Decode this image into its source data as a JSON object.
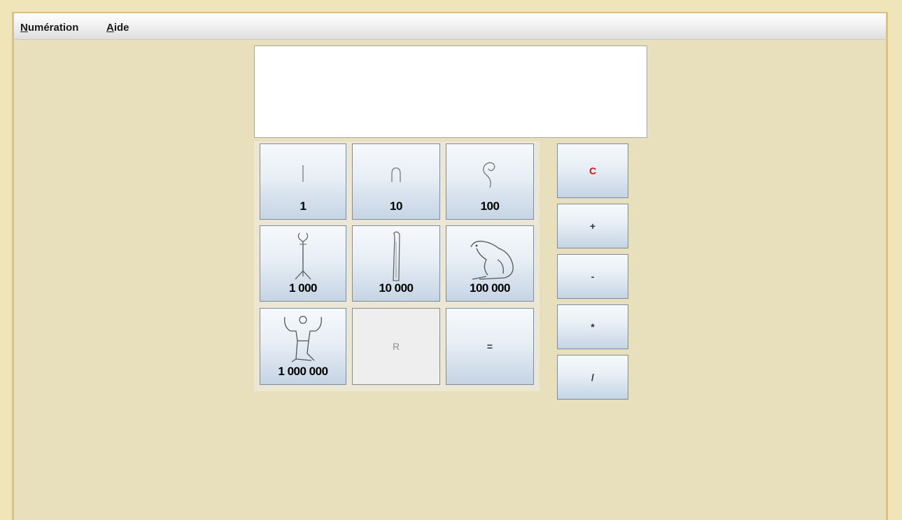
{
  "menu": {
    "numeration": {
      "mnemonic": "N",
      "rest": "umération"
    },
    "aide": {
      "mnemonic": "A",
      "rest": "ide"
    }
  },
  "display": {
    "value": ""
  },
  "numpad": {
    "one": {
      "label": "1",
      "icon": "stroke-hieroglyph-icon"
    },
    "ten": {
      "label": "10",
      "icon": "heel-bone-hieroglyph-icon"
    },
    "hundred": {
      "label": "100",
      "icon": "coil-of-rope-hieroglyph-icon"
    },
    "thousand": {
      "label": "1 000",
      "icon": "lotus-flower-hieroglyph-icon"
    },
    "ten_thousand": {
      "label": "10 000",
      "icon": "finger-hieroglyph-icon"
    },
    "hundred_thousand": {
      "label": "100 000",
      "icon": "tadpole-frog-hieroglyph-icon"
    },
    "million": {
      "label": "1 000 000",
      "icon": "heh-god-hieroglyph-icon"
    },
    "r": {
      "label": "R"
    },
    "equals": {
      "label": "="
    }
  },
  "operators": {
    "clear": {
      "label": "C",
      "color": "#e01010"
    },
    "plus": {
      "label": "+"
    },
    "minus": {
      "label": "-"
    },
    "multiply": {
      "label": "*"
    },
    "divide": {
      "label": "/"
    }
  }
}
